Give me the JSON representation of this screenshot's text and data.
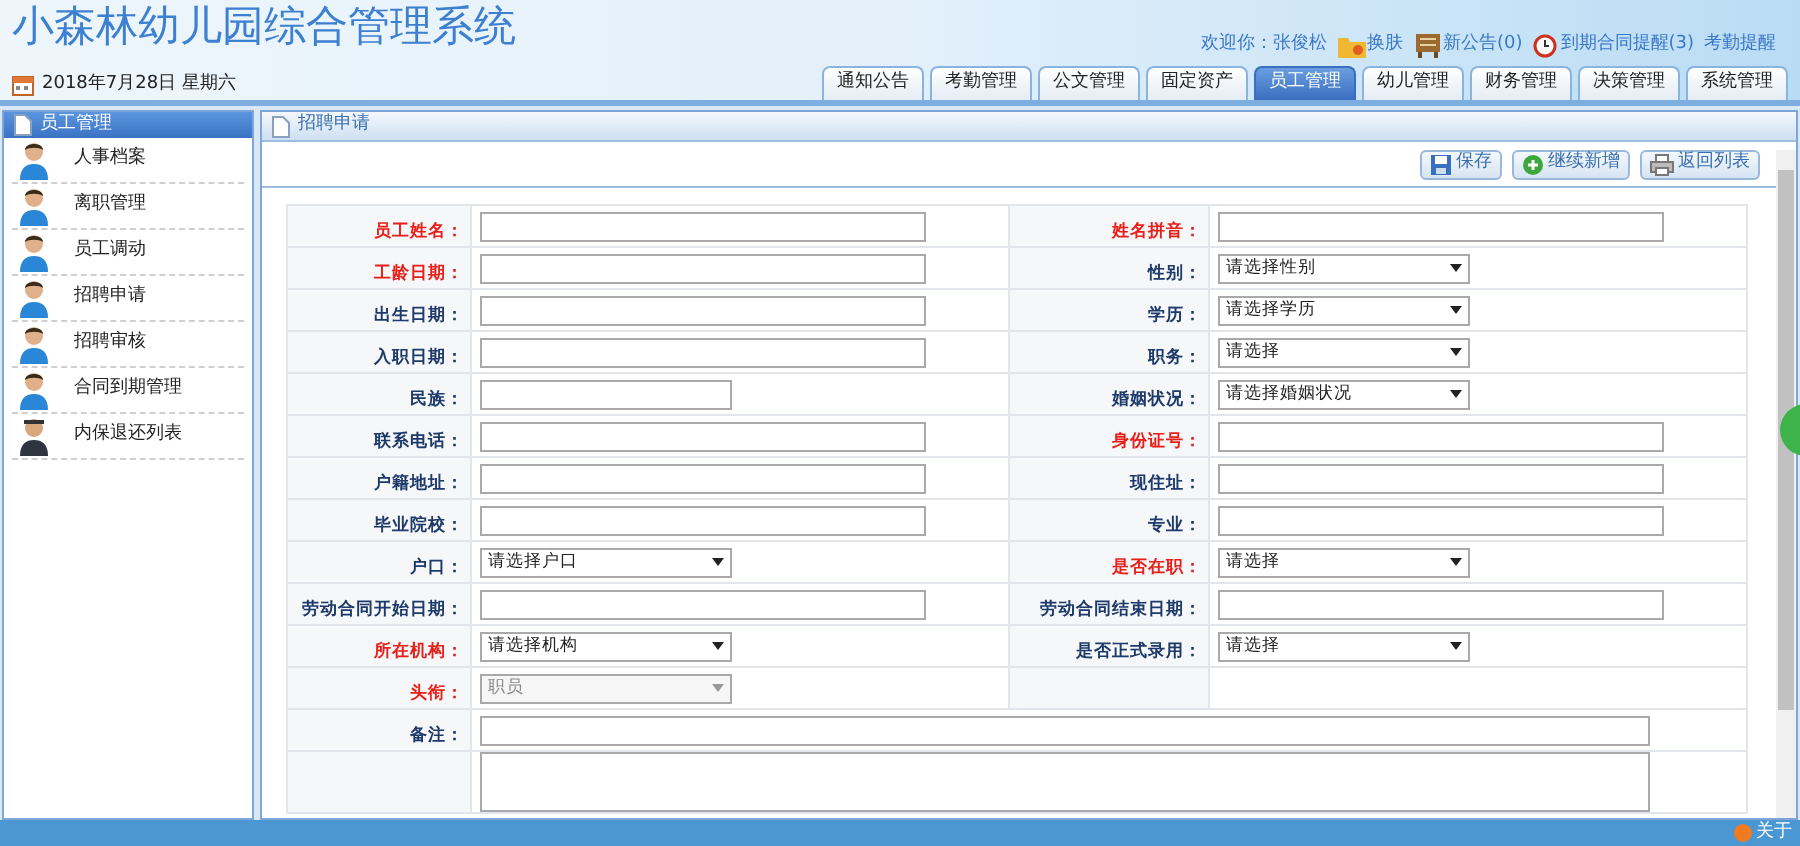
{
  "title": "小森林幼儿园综合管理系统",
  "date": "2018年7月28日 星期六",
  "top_links": [
    {
      "kind": "text",
      "label": "欢迎你：张俊松"
    },
    {
      "kind": "skin",
      "label": "换肤"
    },
    {
      "kind": "notice",
      "label": "新公告(0)"
    },
    {
      "kind": "alarm",
      "label": "到期合同提醒(3)"
    },
    {
      "kind": "plain",
      "label": "考勤提醒"
    }
  ],
  "tabs": [
    {
      "label": "通知公告",
      "selected": false
    },
    {
      "label": "考勤管理",
      "selected": false
    },
    {
      "label": "公文管理",
      "selected": false
    },
    {
      "label": "固定资产",
      "selected": false
    },
    {
      "label": "员工管理",
      "selected": true
    },
    {
      "label": "幼儿管理",
      "selected": false
    },
    {
      "label": "财务管理",
      "selected": false
    },
    {
      "label": "决策管理",
      "selected": false
    },
    {
      "label": "系统管理",
      "selected": false
    }
  ],
  "sidebar": {
    "title": "员工管理",
    "items": [
      {
        "label": "人事档案",
        "kind": "person"
      },
      {
        "label": "离职管理",
        "kind": "person"
      },
      {
        "label": "员工调动",
        "kind": "person"
      },
      {
        "label": "招聘申请",
        "kind": "person"
      },
      {
        "label": "招聘审核",
        "kind": "person"
      },
      {
        "label": "合同到期管理",
        "kind": "person"
      },
      {
        "label": "内保退还列表",
        "kind": "guard"
      }
    ]
  },
  "panel": {
    "title": "招聘申请",
    "buttons": [
      {
        "kind": "save",
        "label": "保存"
      },
      {
        "kind": "add",
        "label": "继续新增"
      },
      {
        "kind": "back",
        "label": "返回列表"
      }
    ]
  },
  "form": [
    [
      {
        "label": "员工姓名：",
        "required": true,
        "kind": "input"
      },
      {
        "label": "姓名拼音：",
        "required": true,
        "kind": "input"
      }
    ],
    [
      {
        "label": "工龄日期：",
        "required": true,
        "kind": "input"
      },
      {
        "label": "性别：",
        "required": false,
        "kind": "select",
        "value": "请选择性别"
      }
    ],
    [
      {
        "label": "出生日期：",
        "required": false,
        "kind": "input"
      },
      {
        "label": "学历：",
        "required": false,
        "kind": "select",
        "value": "请选择学历"
      }
    ],
    [
      {
        "label": "入职日期：",
        "required": false,
        "kind": "input"
      },
      {
        "label": "职务：",
        "required": false,
        "kind": "select",
        "value": "请选择"
      }
    ],
    [
      {
        "label": "民族：",
        "required": false,
        "kind": "short"
      },
      {
        "label": "婚姻状况：",
        "required": false,
        "kind": "select",
        "value": "请选择婚姻状况"
      }
    ],
    [
      {
        "label": "联系电话：",
        "required": false,
        "kind": "input"
      },
      {
        "label": "身份证号：",
        "required": true,
        "kind": "input"
      }
    ],
    [
      {
        "label": "户籍地址：",
        "required": false,
        "kind": "input"
      },
      {
        "label": "现住址：",
        "required": false,
        "kind": "input"
      }
    ],
    [
      {
        "label": "毕业院校：",
        "required": false,
        "kind": "input"
      },
      {
        "label": "专业：",
        "required": false,
        "kind": "input"
      }
    ],
    [
      {
        "label": "户口：",
        "required": false,
        "kind": "select",
        "value": "请选择户口"
      },
      {
        "label": "是否在职：",
        "required": true,
        "kind": "select",
        "value": "请选择"
      }
    ],
    [
      {
        "label": "劳动合同开始日期：",
        "required": false,
        "kind": "input"
      },
      {
        "label": "劳动合同结束日期：",
        "required": false,
        "kind": "input"
      }
    ],
    [
      {
        "label": "所在机构：",
        "required": true,
        "kind": "select",
        "value": "请选择机构"
      },
      {
        "label": "是否正式录用：",
        "required": false,
        "kind": "select",
        "value": "请选择"
      }
    ],
    [
      {
        "label": "头衔：",
        "required": true,
        "kind": "select",
        "value": "职员",
        "disabled": true
      },
      {
        "kind": "empty"
      }
    ],
    [
      {
        "label": "备注：",
        "required": false,
        "kind": "wide"
      }
    ],
    [
      {
        "kind": "textarea"
      }
    ]
  ],
  "footer": {
    "label": "关于"
  }
}
